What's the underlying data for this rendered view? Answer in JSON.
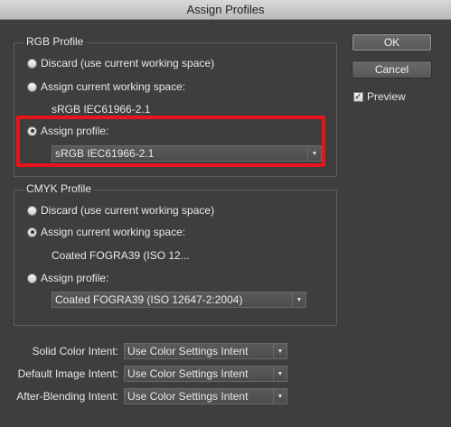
{
  "window": {
    "title": "Assign Profiles"
  },
  "rgb": {
    "group_title": "RGB Profile",
    "discard_label": "Discard (use current working space)",
    "assign_working_label": "Assign current working space:",
    "working_space_value": "sRGB IEC61966-2.1",
    "assign_profile_label": "Assign profile:",
    "profile_select_value": "sRGB IEC61966-2.1",
    "selected_option": "assign_profile"
  },
  "cmyk": {
    "group_title": "CMYK Profile",
    "discard_label": "Discard (use current working space)",
    "assign_working_label": "Assign current working space:",
    "working_space_value": "Coated FOGRA39 (ISO 12...",
    "assign_profile_label": "Assign profile:",
    "profile_select_value": "Coated FOGRA39 (ISO 12647-2:2004)",
    "selected_option": "assign_working"
  },
  "intents": {
    "solid_label": "Solid Color Intent:",
    "solid_value": "Use Color Settings Intent",
    "image_label": "Default Image Intent:",
    "image_value": "Use Color Settings Intent",
    "blend_label": "After-Blending Intent:",
    "blend_value": "Use Color Settings Intent"
  },
  "buttons": {
    "ok_label": "OK",
    "cancel_label": "Cancel"
  },
  "preview": {
    "label": "Preview",
    "checked": true
  },
  "colors": {
    "highlight": "#e8141b",
    "background": "#3e3e3e"
  }
}
